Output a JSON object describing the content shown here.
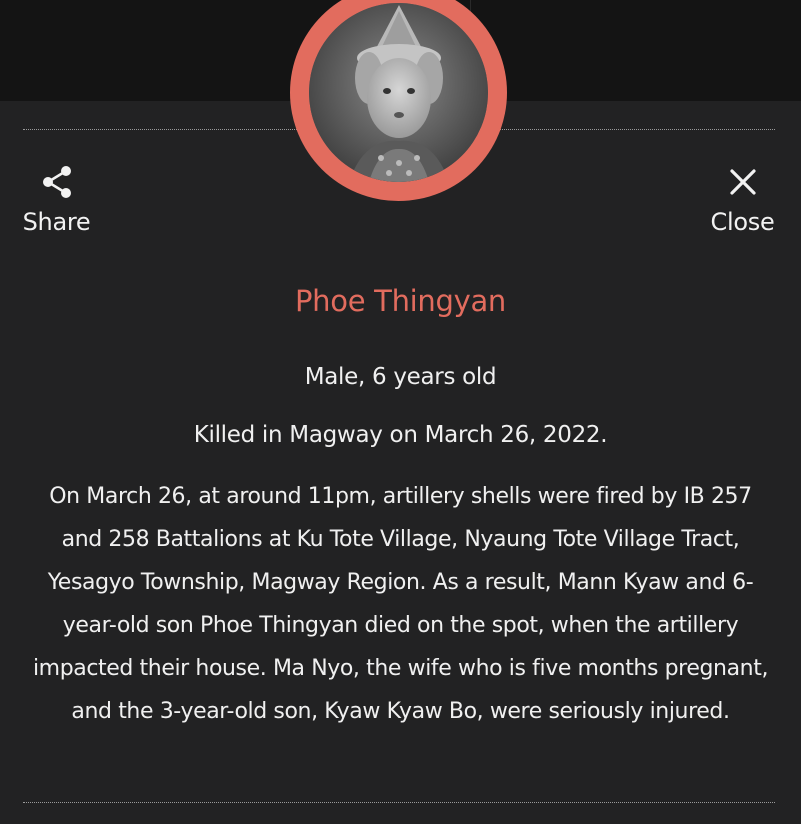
{
  "toolbar": {
    "share_label": "Share",
    "share_icon": "share-icon",
    "close_label": "Close",
    "close_icon": "close-icon"
  },
  "profile": {
    "name": "Phoe Thingyan",
    "gender_age": "Male, 6 years old",
    "killed": "Killed in Magway on March 26, 2022.",
    "story": "On March 26, at around 11pm, artillery shells were fired by IB 257 and 258 Battalions at Ku Tote Village, Nyaung Tote Village Tract, Yesagyo Township, Magway Region. As a result, Mann Kyaw and 6-year-old son Phoe Thingyan died on the spot, when the artillery impacted their house. Ma Nyo, the wife who is five months pregnant, and the 3-year-old son, Kyaw Kyaw Bo, were seriously injured."
  },
  "colors": {
    "background": "#222223",
    "top_band": "#141414",
    "accent": "#e26c5e",
    "text": "#f0f0f0"
  }
}
